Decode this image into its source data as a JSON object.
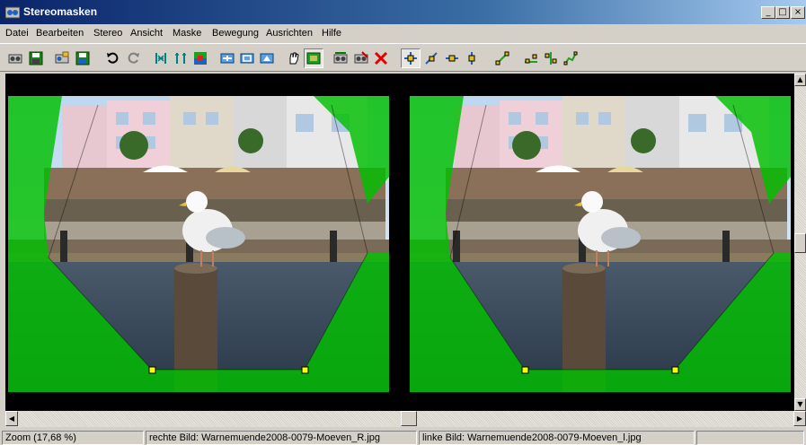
{
  "window": {
    "title": "Stereomasken"
  },
  "menu": {
    "items": [
      "Datei",
      "Bearbeiten",
      "Stereo",
      "Ansicht",
      "Maske",
      "Bewegung",
      "Ausrichten",
      "Hilfe"
    ]
  },
  "toolbar": {
    "icons": [
      "open-pair-icon",
      "save-icon",
      "open-image-icon",
      "save-image-icon",
      "undo-icon",
      "redo-icon",
      "flip-icon",
      "split-icon",
      "mask-color-icon",
      "move-icon",
      "fit-icon",
      "zoom-icon",
      "hand-icon",
      "mask-toggle-icon",
      "animate-icon",
      "animate-mask-icon",
      "delete-mask-icon",
      "move-points-icon",
      "add-point-icon",
      "move-horizontal-icon",
      "move-vertical-icon",
      "edit-point-icon",
      "edge-icon",
      "align-icon",
      "path-icon"
    ]
  },
  "images": {
    "right_label": "rechte Bild",
    "left_label": "linke Bild",
    "mask_color": "#00c000"
  },
  "status": {
    "zoom": "Zoom (17,68 %)",
    "right": "rechte Bild: Warnemuende2008-0079-Moeven_R.jpg",
    "left": "linke Bild: Warnemuende2008-0079-Moeven_l.jpg"
  }
}
